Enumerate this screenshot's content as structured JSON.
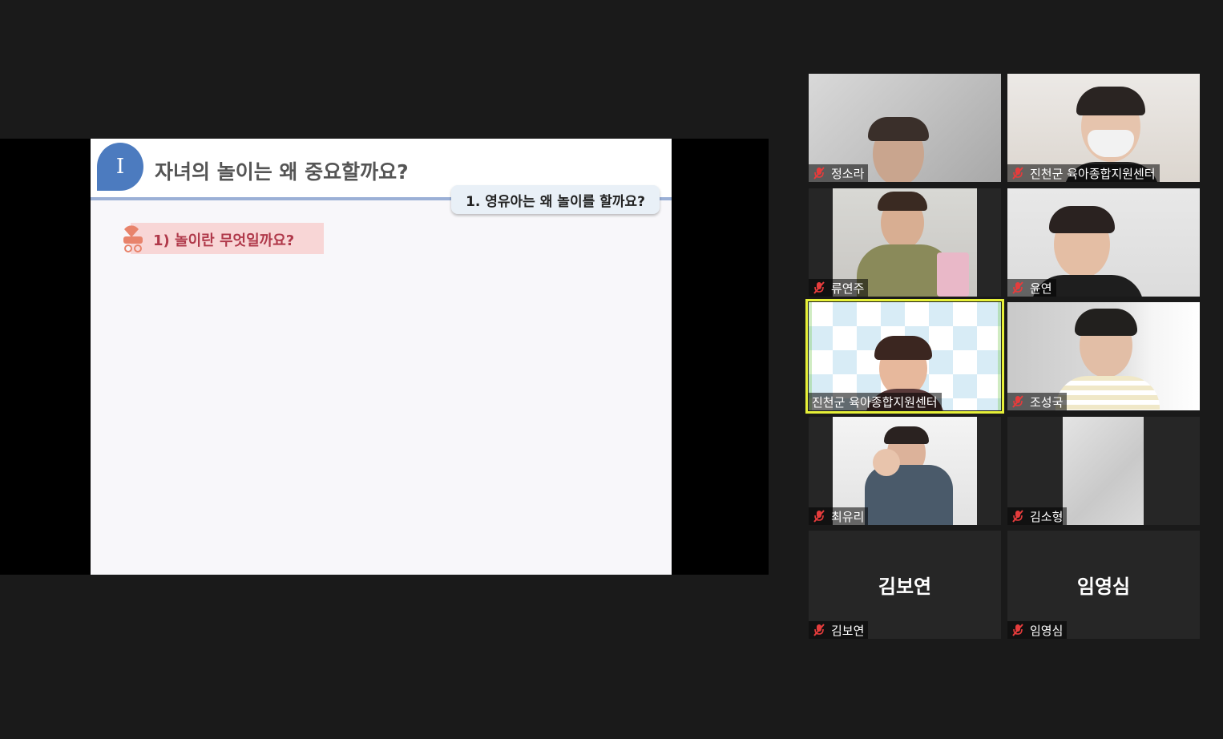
{
  "slide": {
    "badge": "I",
    "title": "자녀의 놀이는 왜 중요할까요?",
    "subtab": "1. 영유아는 왜 놀이를 할까요?",
    "section_label": "1) 놀이란 무엇일까요?"
  },
  "participants": [
    {
      "name": "정소라",
      "muted": true
    },
    {
      "name": "진천군 육아종합지원센터",
      "muted": true
    },
    {
      "name": "류연주",
      "muted": true
    },
    {
      "name": "윤연",
      "muted": true
    },
    {
      "name": "진천군 육아종합지원센터",
      "muted": false,
      "active_speaker": true
    },
    {
      "name": "조성국",
      "muted": true
    },
    {
      "name": "최유리",
      "muted": true
    },
    {
      "name": "김소형",
      "muted": true
    },
    {
      "name": "김보연",
      "muted": true,
      "display_name": "김보연"
    },
    {
      "name": "임영심",
      "muted": true,
      "display_name": "임영심"
    }
  ],
  "colors": {
    "background": "#1a1a1a",
    "active_outline": "#e6f038",
    "muted_icon": "#e53c3c",
    "slide_badge": "#4c7bbf",
    "section_text": "#b0394a"
  }
}
